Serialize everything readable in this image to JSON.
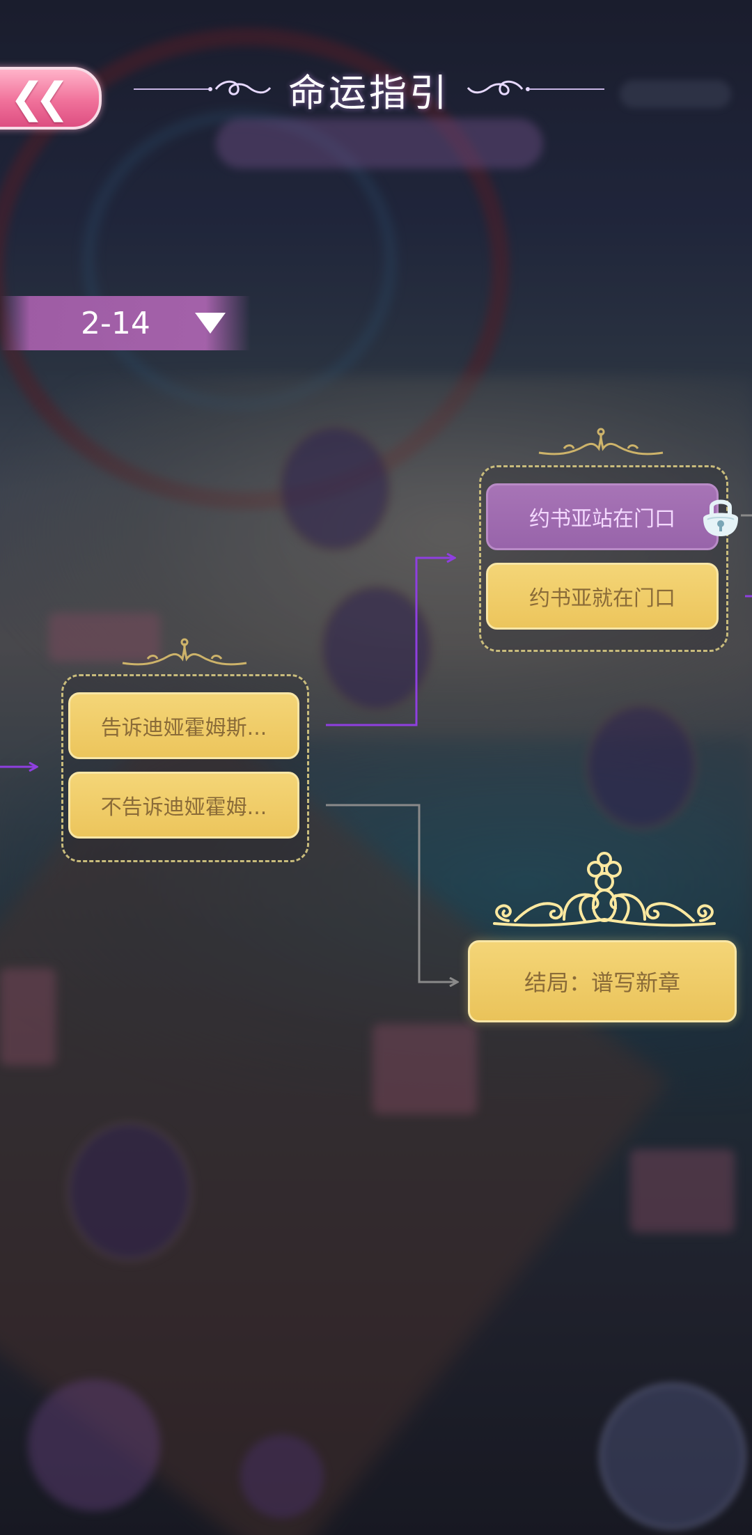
{
  "header": {
    "back_icon": "double-chevron-left-icon",
    "title": "命运指引"
  },
  "chapter_selector": {
    "value": "2-14",
    "icon": "triangle-down-icon"
  },
  "choices": {
    "group1": [
      {
        "text": "告诉迪娅霍姆斯...",
        "state": "available"
      },
      {
        "text": "不告诉迪娅霍姆...",
        "state": "available"
      }
    ],
    "group2": [
      {
        "text": "约书亚站在门口",
        "state": "locked"
      },
      {
        "text": "约书亚就在门口",
        "state": "available"
      }
    ]
  },
  "ending": {
    "text": "结局：谱写新章",
    "icon": "crown-icon"
  },
  "colors": {
    "accent_purple": "#8f3fe0",
    "choice_gold": "#efca62",
    "choice_locked": "#9d68ae",
    "connector_gray": "#8a8a8a"
  }
}
